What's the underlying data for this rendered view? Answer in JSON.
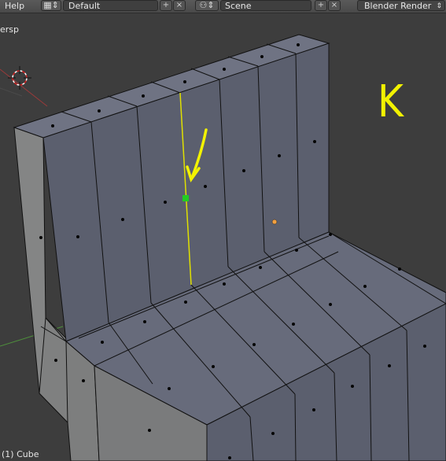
{
  "header": {
    "menu_help": "Help",
    "screen_layout": "Default",
    "scene_name": "Scene",
    "render_engine": "Blender Render",
    "layout_icon": "screen-layout-icon",
    "scene_icon": "scene-icon",
    "add_icon": "plus-icon",
    "close_icon": "close-icon",
    "dropdown_icon": "chevron-updown-icon"
  },
  "viewport": {
    "view_label": "ersp",
    "object_info": "(1) Cube",
    "annotation_letter": "K",
    "cursor_icon": "3d-cursor-icon",
    "arrow_icon": "annotation-arrow-icon"
  },
  "colors": {
    "background": "#3d3d3d",
    "mesh_face": "#5b5f6e",
    "annotation": "#f2f200",
    "selected_vertex": "#22cc22",
    "origin_dot": "#f2a040"
  }
}
